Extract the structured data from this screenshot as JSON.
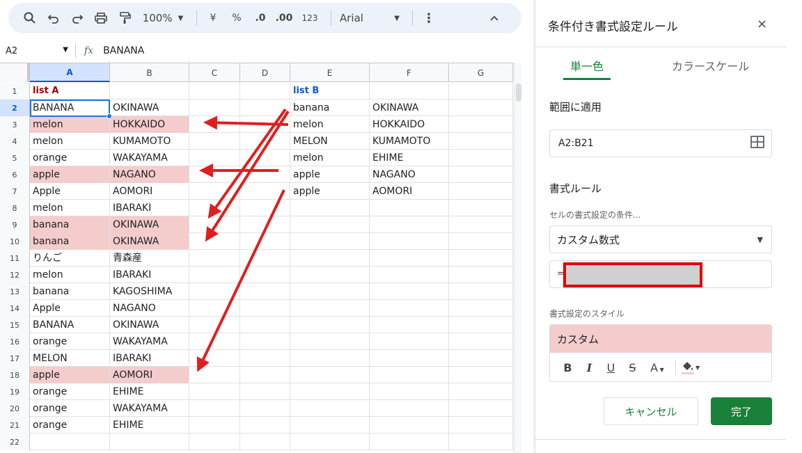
{
  "toolbar": {
    "zoom": "100%",
    "currency": "¥",
    "percent": "%",
    "dec_decrease": ".0",
    "dec_increase": ".00",
    "number_format": "123",
    "font": "Arial"
  },
  "formula_bar": {
    "cell_ref": "A2",
    "fx": "fx",
    "value": "BANANA"
  },
  "columns": [
    "A",
    "B",
    "C",
    "D",
    "E",
    "F",
    "G"
  ],
  "rows": [
    {
      "n": "1",
      "a": "list A",
      "b": "",
      "e": "list B",
      "f": ""
    },
    {
      "n": "2",
      "a": "BANANA",
      "b": "OKINAWA",
      "e": "banana",
      "f": "OKINAWA"
    },
    {
      "n": "3",
      "a": "melon",
      "b": "HOKKAIDO",
      "e": "melon",
      "f": "HOKKAIDO",
      "hl": true
    },
    {
      "n": "4",
      "a": "melon",
      "b": "KUMAMOTO",
      "e": "MELON",
      "f": "KUMAMOTO"
    },
    {
      "n": "5",
      "a": "orange",
      "b": "WAKAYAMA",
      "e": "melon",
      "f": "EHIME"
    },
    {
      "n": "6",
      "a": "apple",
      "b": "NAGANO",
      "e": "apple",
      "f": "NAGANO",
      "hl": true
    },
    {
      "n": "7",
      "a": "Apple",
      "b": "AOMORI",
      "e": "apple",
      "f": "AOMORI"
    },
    {
      "n": "8",
      "a": "melon",
      "b": "IBARAKI",
      "e": "",
      "f": ""
    },
    {
      "n": "9",
      "a": "banana",
      "b": "OKINAWA",
      "e": "",
      "f": "",
      "hl": true
    },
    {
      "n": "10",
      "a": "banana",
      "b": "OKINAWA",
      "e": "",
      "f": "",
      "hl": true
    },
    {
      "n": "11",
      "a": "りんご",
      "b": "青森産",
      "e": "",
      "f": ""
    },
    {
      "n": "12",
      "a": "melon",
      "b": "IBARAKI",
      "e": "",
      "f": ""
    },
    {
      "n": "13",
      "a": "banana",
      "b": "KAGOSHIMA",
      "e": "",
      "f": ""
    },
    {
      "n": "14",
      "a": "Apple",
      "b": "NAGANO",
      "e": "",
      "f": ""
    },
    {
      "n": "15",
      "a": "BANANA",
      "b": "OKINAWA",
      "e": "",
      "f": ""
    },
    {
      "n": "16",
      "a": "orange",
      "b": "WAKAYAMA",
      "e": "",
      "f": ""
    },
    {
      "n": "17",
      "a": "MELON",
      "b": "IBARAKI",
      "e": "",
      "f": ""
    },
    {
      "n": "18",
      "a": "apple",
      "b": "AOMORI",
      "e": "",
      "f": "",
      "hl": true
    },
    {
      "n": "19",
      "a": "orange",
      "b": "EHIME",
      "e": "",
      "f": ""
    },
    {
      "n": "20",
      "a": "orange",
      "b": "WAKAYAMA",
      "e": "",
      "f": ""
    },
    {
      "n": "21",
      "a": "orange",
      "b": "EHIME",
      "e": "",
      "f": ""
    },
    {
      "n": "22",
      "a": "",
      "b": "",
      "e": "",
      "f": ""
    }
  ],
  "panel": {
    "title": "条件付き書式設定ルール",
    "close": "×",
    "tab_single": "単一色",
    "tab_scale": "カラースケール",
    "apply_label": "範囲に適用",
    "range": "A2:B21",
    "rules_label": "書式ルール",
    "condition_label": "セルの書式設定の条件...",
    "condition_value": "カスタム数式",
    "formula_prefix": "=",
    "style_label": "書式設定のスタイル",
    "style_value": "カスタム",
    "bold": "B",
    "italic": "I",
    "underline": "U",
    "strike": "S",
    "textcolor": "A",
    "cancel": "キャンセル",
    "done": "完了"
  },
  "colors": {
    "highlight": "#f4cccc",
    "list_a": "#990000",
    "list_b": "#1155cc",
    "accent": "#188038",
    "arrow": "#e01e1e"
  }
}
